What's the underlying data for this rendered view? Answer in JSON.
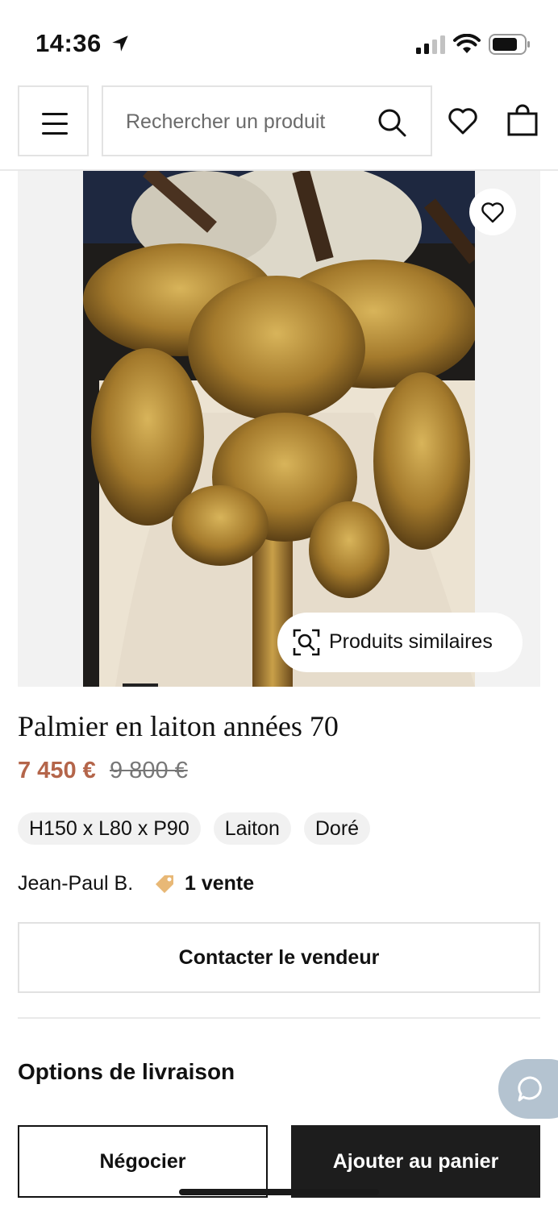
{
  "status_bar": {
    "time": "14:36"
  },
  "header": {
    "search_placeholder": "Rechercher un produit"
  },
  "gallery": {
    "similar_label": "Produits similaires"
  },
  "product": {
    "title": "Palmier en laiton années 70",
    "price": "7 450 €",
    "old_price": "9 800 €",
    "tags": [
      "H150 x L80 x P90",
      "Laiton",
      "Doré"
    ],
    "seller_name": "Jean-Paul B.",
    "sales_count": "1 vente"
  },
  "actions": {
    "contact_label": "Contacter le vendeur",
    "shipping_label": "Options de livraison",
    "negotiate_label": "Négocier",
    "add_to_cart_label": "Ajouter au panier"
  },
  "colors": {
    "price": "#b4654a",
    "primary_button": "#1d1d1d",
    "chat_bubble": "#b4c3d0"
  },
  "icons": [
    "location-arrow-icon",
    "signal-icon",
    "wifi-icon",
    "battery-icon",
    "menu-icon",
    "search-icon",
    "heart-icon",
    "bag-icon",
    "visual-search-icon",
    "tag-icon",
    "chat-icon"
  ]
}
